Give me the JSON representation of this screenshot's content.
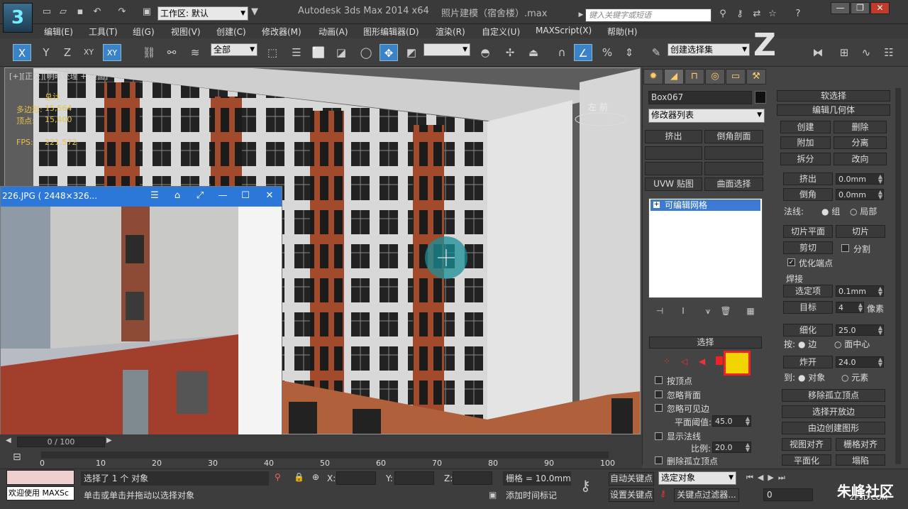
{
  "title_bar": {
    "workspace_label": "工作区: 默认",
    "app_title": "Autodesk 3ds Max  2014 x64",
    "file_title": "照片建模（宿舍楼）.max",
    "search_placeholder": "键入关键字或短语"
  },
  "menu": [
    "编辑(E)",
    "工具(T)",
    "组(G)",
    "视图(V)",
    "创建(C)",
    "修改器(M)",
    "动画(A)",
    "图形编辑器(D)",
    "渲染(R)",
    "自定义(U)",
    "MAXScript(X)",
    "帮助(H)"
  ],
  "toolbar": {
    "axis_buttons": [
      "X",
      "Y",
      "Z",
      "XY",
      "XY"
    ],
    "filter_value": "全部",
    "selection_set": "创建选择集"
  },
  "viewport": {
    "label": "[+][正交][明暗处理 + 边面]",
    "stats": {
      "title": "总计",
      "poly_label": "多边形:",
      "poly_value": "15,564",
      "vert_label": "顶点:",
      "vert_value": "15,400",
      "fps_label": "FPS:",
      "fps_value": "221.572"
    },
    "viewcube_label": "左  前"
  },
  "photo_window": {
    "filename": "226.JPG ( 2448×326..."
  },
  "command_panel": {
    "object_name": "Box067",
    "modifier_list": "修改器列表",
    "buttons": [
      "挤出",
      "倒角剖面",
      "",
      "",
      "",
      "",
      "UVW 贴图",
      "曲面选择"
    ],
    "stack_item": "可编辑网格",
    "selection_rollout": {
      "title": "选择",
      "by_vertex": "按顶点",
      "ignore_back": "忽略背面",
      "ignore_visible_edges": "忽略可见边",
      "planar_threshold_label": "平面阈值:",
      "planar_threshold_value": "45.0",
      "show_normals": "显示法线",
      "scale_label": "比例:",
      "scale_value": "20.0",
      "delete_isolated": "删除孤立顶点"
    }
  },
  "edit_geometry": {
    "soft_selection": "软选择",
    "rollout_title": "编辑几何体",
    "create": "创建",
    "delete": "删除",
    "attach": "附加",
    "detach": "分离",
    "divide": "拆分",
    "turn": "改向",
    "extrude": "挤出",
    "extrude_value": "0.0mm",
    "chamfer": "倒角",
    "chamfer_value": "0.0mm",
    "normal_label": "法线:",
    "group": "组",
    "local": "局部",
    "slice_plane": "切片平面",
    "slice": "切片",
    "cut": "剪切",
    "split": "分割",
    "refine_ends": "优化端点",
    "weld_title": "焊接",
    "selected": "选定项",
    "selected_value": "0.1mm",
    "target": "目标",
    "target_value": "4",
    "pixels": "像素",
    "tessellate": "细化",
    "tessellate_value": "25.0",
    "by_label": "按:",
    "edge": "边",
    "face_center": "面中心",
    "explode": "炸开",
    "explode_value": "24.0",
    "to_label": "到:",
    "objects": "对象",
    "elements": "元素",
    "remove_isolated": "移除孤立顶点",
    "select_open_edges": "选择开放边",
    "create_shape_from_edges": "由边创建图形",
    "view_align": "视图对齐",
    "grid_align": "栅格对齐",
    "planarize": "平面化",
    "collapse": "塌陷"
  },
  "timeline": {
    "slider_label": "0 / 100",
    "ticks": [
      "0",
      "10",
      "20",
      "30",
      "40",
      "50",
      "60",
      "70",
      "80",
      "90",
      "100"
    ]
  },
  "status": {
    "maxscript_label": "欢迎使用 MAXSc",
    "selected_text": "选择了 1 个 对象",
    "prompt_text": "单击或单击并拖动以选择对象",
    "x_label": "X:",
    "y_label": "Y:",
    "z_label": "Z:",
    "grid_text": "栅格 = 10.0mm",
    "add_time_tag": "添加时间标记",
    "auto_key": "自动关键点",
    "set_key": "设置关键点",
    "selected_object": "选定对象",
    "key_filters": "关键点过滤器...",
    "frame_value": "0"
  },
  "watermark": {
    "brand": "朱峰社区",
    "url": "ZF3D.COM"
  }
}
